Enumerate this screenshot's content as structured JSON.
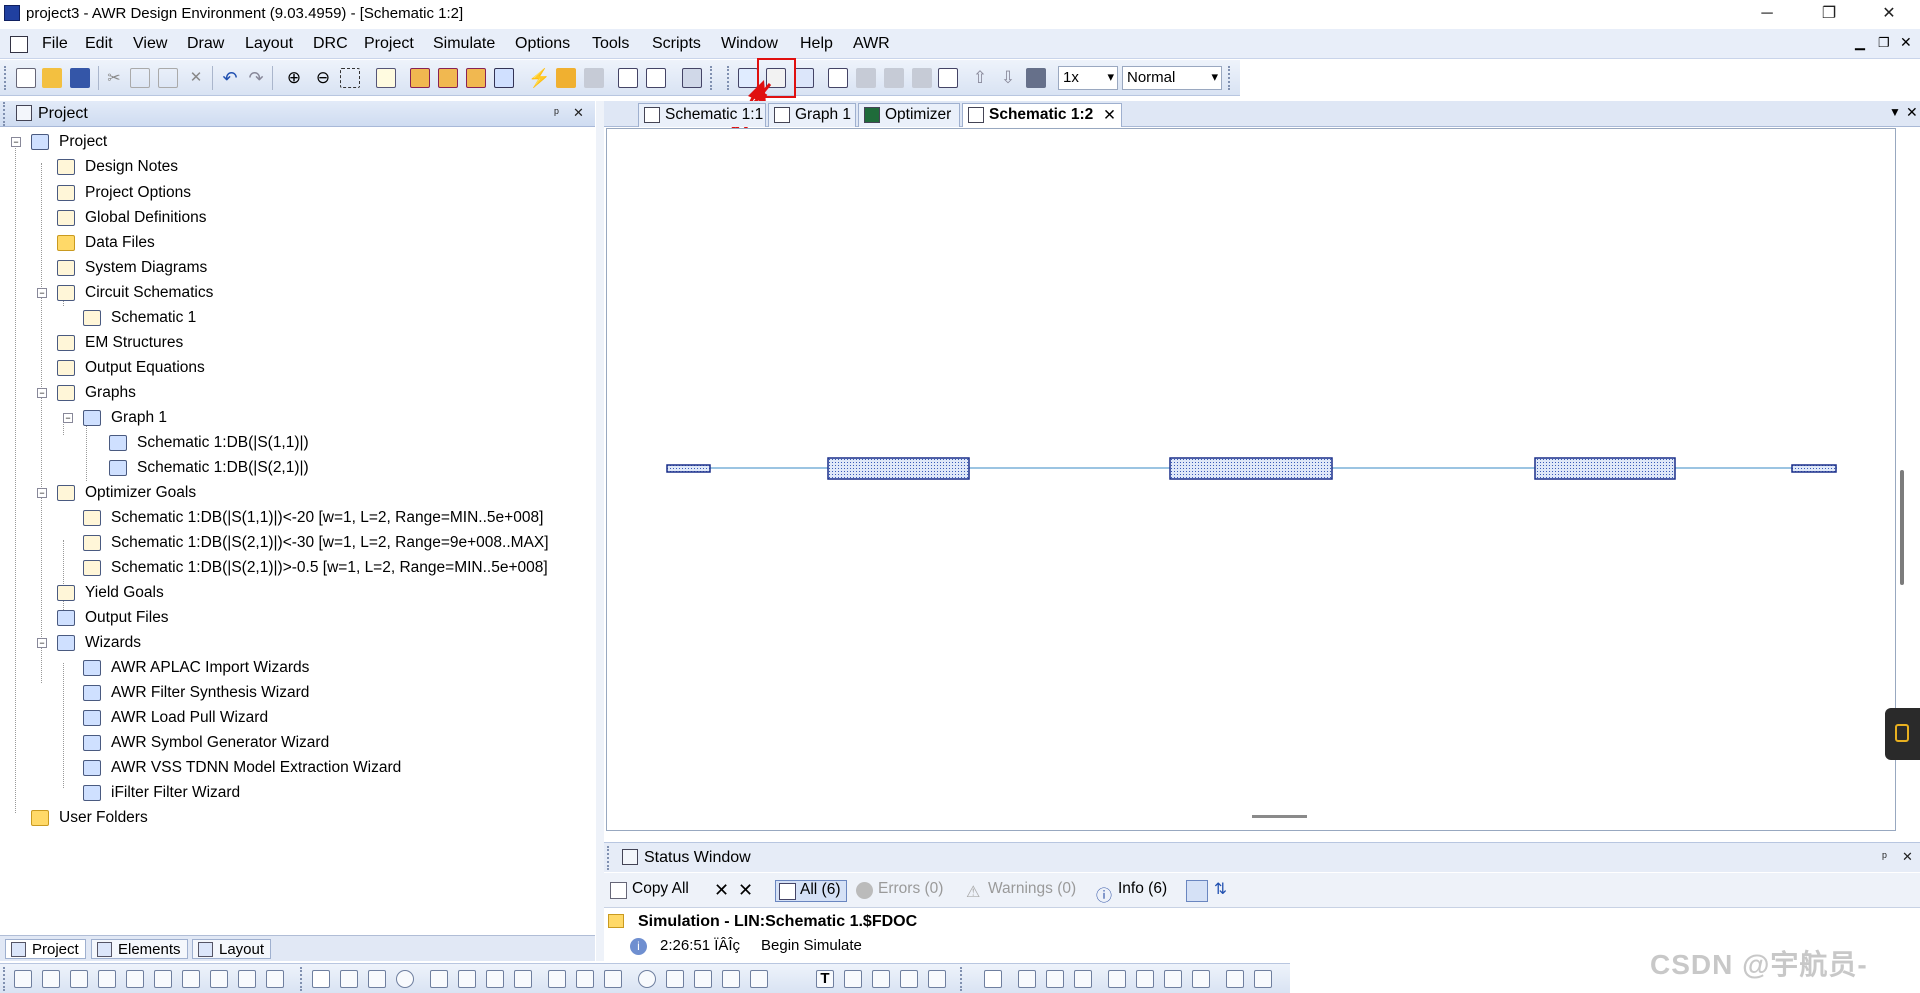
{
  "window": {
    "title": "project3 - AWR Design Environment (9.03.4959) - [Schematic 1:2]",
    "minimize": "─",
    "restore": "❐",
    "close": "✕"
  },
  "menu": [
    "File",
    "Edit",
    "View",
    "Draw",
    "Layout",
    "DRC",
    "Project",
    "Simulate",
    "Options",
    "Tools",
    "Scripts",
    "Window",
    "Help",
    "AWR"
  ],
  "toolbar": {
    "zoom_value": "1x",
    "mode_value": "Normal"
  },
  "project_panel": {
    "title": "Project",
    "pin": "ᵖ",
    "close": "✕"
  },
  "tree": [
    {
      "label": "Project",
      "level": 0
    },
    {
      "label": "Design Notes",
      "level": 1
    },
    {
      "label": "Project Options",
      "level": 1
    },
    {
      "label": "Global Definitions",
      "level": 1
    },
    {
      "label": "Data Files",
      "level": 1
    },
    {
      "label": "System Diagrams",
      "level": 1
    },
    {
      "label": "Circuit Schematics",
      "level": 1
    },
    {
      "label": "Schematic 1",
      "level": 2
    },
    {
      "label": "EM Structures",
      "level": 1
    },
    {
      "label": "Output Equations",
      "level": 1
    },
    {
      "label": "Graphs",
      "level": 1
    },
    {
      "label": "Graph 1",
      "level": 2
    },
    {
      "label": "Schematic 1:DB(|S(1,1)|)",
      "level": 3
    },
    {
      "label": "Schematic 1:DB(|S(2,1)|)",
      "level": 3
    },
    {
      "label": "Optimizer Goals",
      "level": 1
    },
    {
      "label": "Schematic 1:DB(|S(1,1)|)<-20 [w=1, L=2, Range=MIN..5e+008]",
      "level": 2
    },
    {
      "label": "Schematic 1:DB(|S(2,1)|)<-30 [w=1, L=2, Range=9e+008..MAX]",
      "level": 2
    },
    {
      "label": "Schematic 1:DB(|S(2,1)|)>-0.5 [w=1, L=2, Range=MIN..5e+008]",
      "level": 2
    },
    {
      "label": "Yield Goals",
      "level": 1
    },
    {
      "label": "Output Files",
      "level": 1
    },
    {
      "label": "Wizards",
      "level": 1
    },
    {
      "label": "AWR APLAC Import Wizards",
      "level": 2
    },
    {
      "label": "AWR Filter Synthesis Wizard",
      "level": 2
    },
    {
      "label": "AWR Load Pull Wizard",
      "level": 2
    },
    {
      "label": "AWR Symbol Generator Wizard",
      "level": 2
    },
    {
      "label": "AWR VSS TDNN Model Extraction Wizard",
      "level": 2
    },
    {
      "label": "iFilter Filter Wizard",
      "level": 2
    },
    {
      "label": "User Folders",
      "level": 0
    }
  ],
  "bottom_tabs": [
    "Project",
    "Elements",
    "Layout"
  ],
  "doc_tabs": [
    "Schematic 1:1",
    "Graph 1",
    "Optimizer",
    "Schematic 1:2"
  ],
  "doc_close": "✕",
  "status_window": {
    "title": "Status Window",
    "copy_all": "Copy All",
    "all": "All (6)",
    "errors": "Errors (0)",
    "warnings": "Warnings (0)",
    "info": "Info (6)",
    "sim_title": "Simulation",
    "sim_detail": " - LIN:Schematic 1.$FDOC",
    "msg_time": "2:26:51 ÏÂÎç",
    "msg_text": "Begin Simulate"
  },
  "watermark": "CSDN @宇航员-",
  "colors": {
    "accent_red": "#e01010",
    "schematic_block": "#1a2f8a",
    "schematic_fill": "#c8d6f0"
  }
}
